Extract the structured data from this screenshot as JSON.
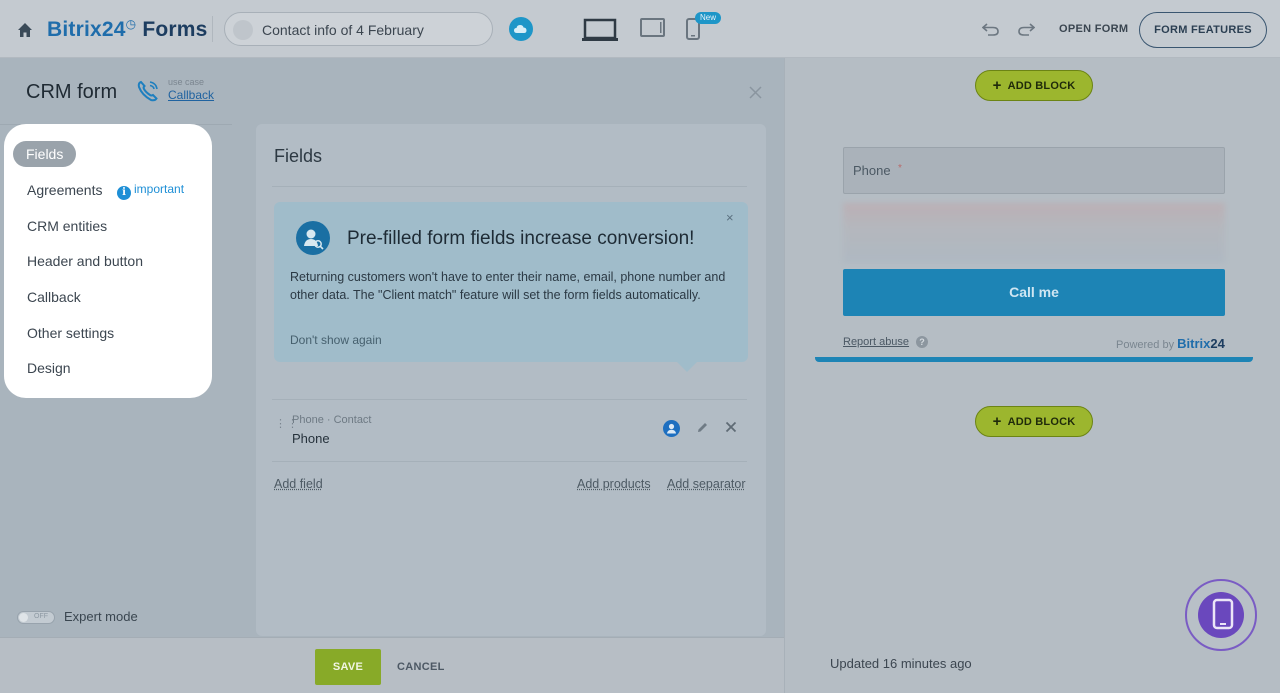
{
  "header": {
    "brand_prefix": "Bitrix24",
    "brand_clock": "◷",
    "brand_suffix": "Forms",
    "form_title": "Contact info of 4 February",
    "new_badge": "New",
    "open_form_label": "OPEN FORM",
    "features_label": "FORM FEATURES",
    "icons": [
      "home-icon",
      "cloud-icon",
      "laptop-icon",
      "tablet-icon",
      "phone-icon",
      "undo-icon",
      "redo-icon"
    ]
  },
  "left": {
    "title": "CRM form",
    "use_case_label": "use case",
    "use_case_value": "Callback",
    "menu": {
      "items": [
        {
          "label": "Fields",
          "active": true
        },
        {
          "label": "Agreements",
          "active": false
        },
        {
          "label": "CRM entities",
          "active": false
        },
        {
          "label": "Header and button",
          "active": false
        },
        {
          "label": "Callback",
          "active": false
        },
        {
          "label": "Other settings",
          "active": false
        },
        {
          "label": "Design",
          "active": false
        }
      ],
      "important_label": "important",
      "important_icon": "i"
    },
    "card": {
      "title": "Fields",
      "promo": {
        "title": "Pre-filled form fields increase conversion!",
        "text": "Returning customers won't have to enter their name, email, phone number and other data. The \"Client match\" feature will set the form fields automatically.",
        "dismiss": "Don't show again",
        "close": "×"
      },
      "field": {
        "sub": "Phone · Contact",
        "name": "Phone"
      },
      "add_field": "Add field",
      "add_products": "Add products",
      "add_separator": "Add separator"
    },
    "expert_mode": {
      "label": "Expert mode",
      "toggle_text": "OFF",
      "enabled": false
    },
    "footer": {
      "save": "SAVE",
      "cancel": "CANCEL"
    }
  },
  "right": {
    "add_block": "ADD BLOCK",
    "add_block_plus": "+",
    "phone_placeholder": "Phone",
    "required_mark": "*",
    "call_button": "Call me",
    "report_abuse": "Report abuse",
    "help": "?",
    "powered_by": "Powered by",
    "powered_brand_a": "Bitrix",
    "powered_brand_b": "24",
    "updated": "Updated 16 minutes ago"
  },
  "colors": {
    "accent_blue": "#1e96c8",
    "save_green": "#88aa28",
    "add_block_green": "#9cb62e",
    "fab_purple": "#6a48bd"
  }
}
